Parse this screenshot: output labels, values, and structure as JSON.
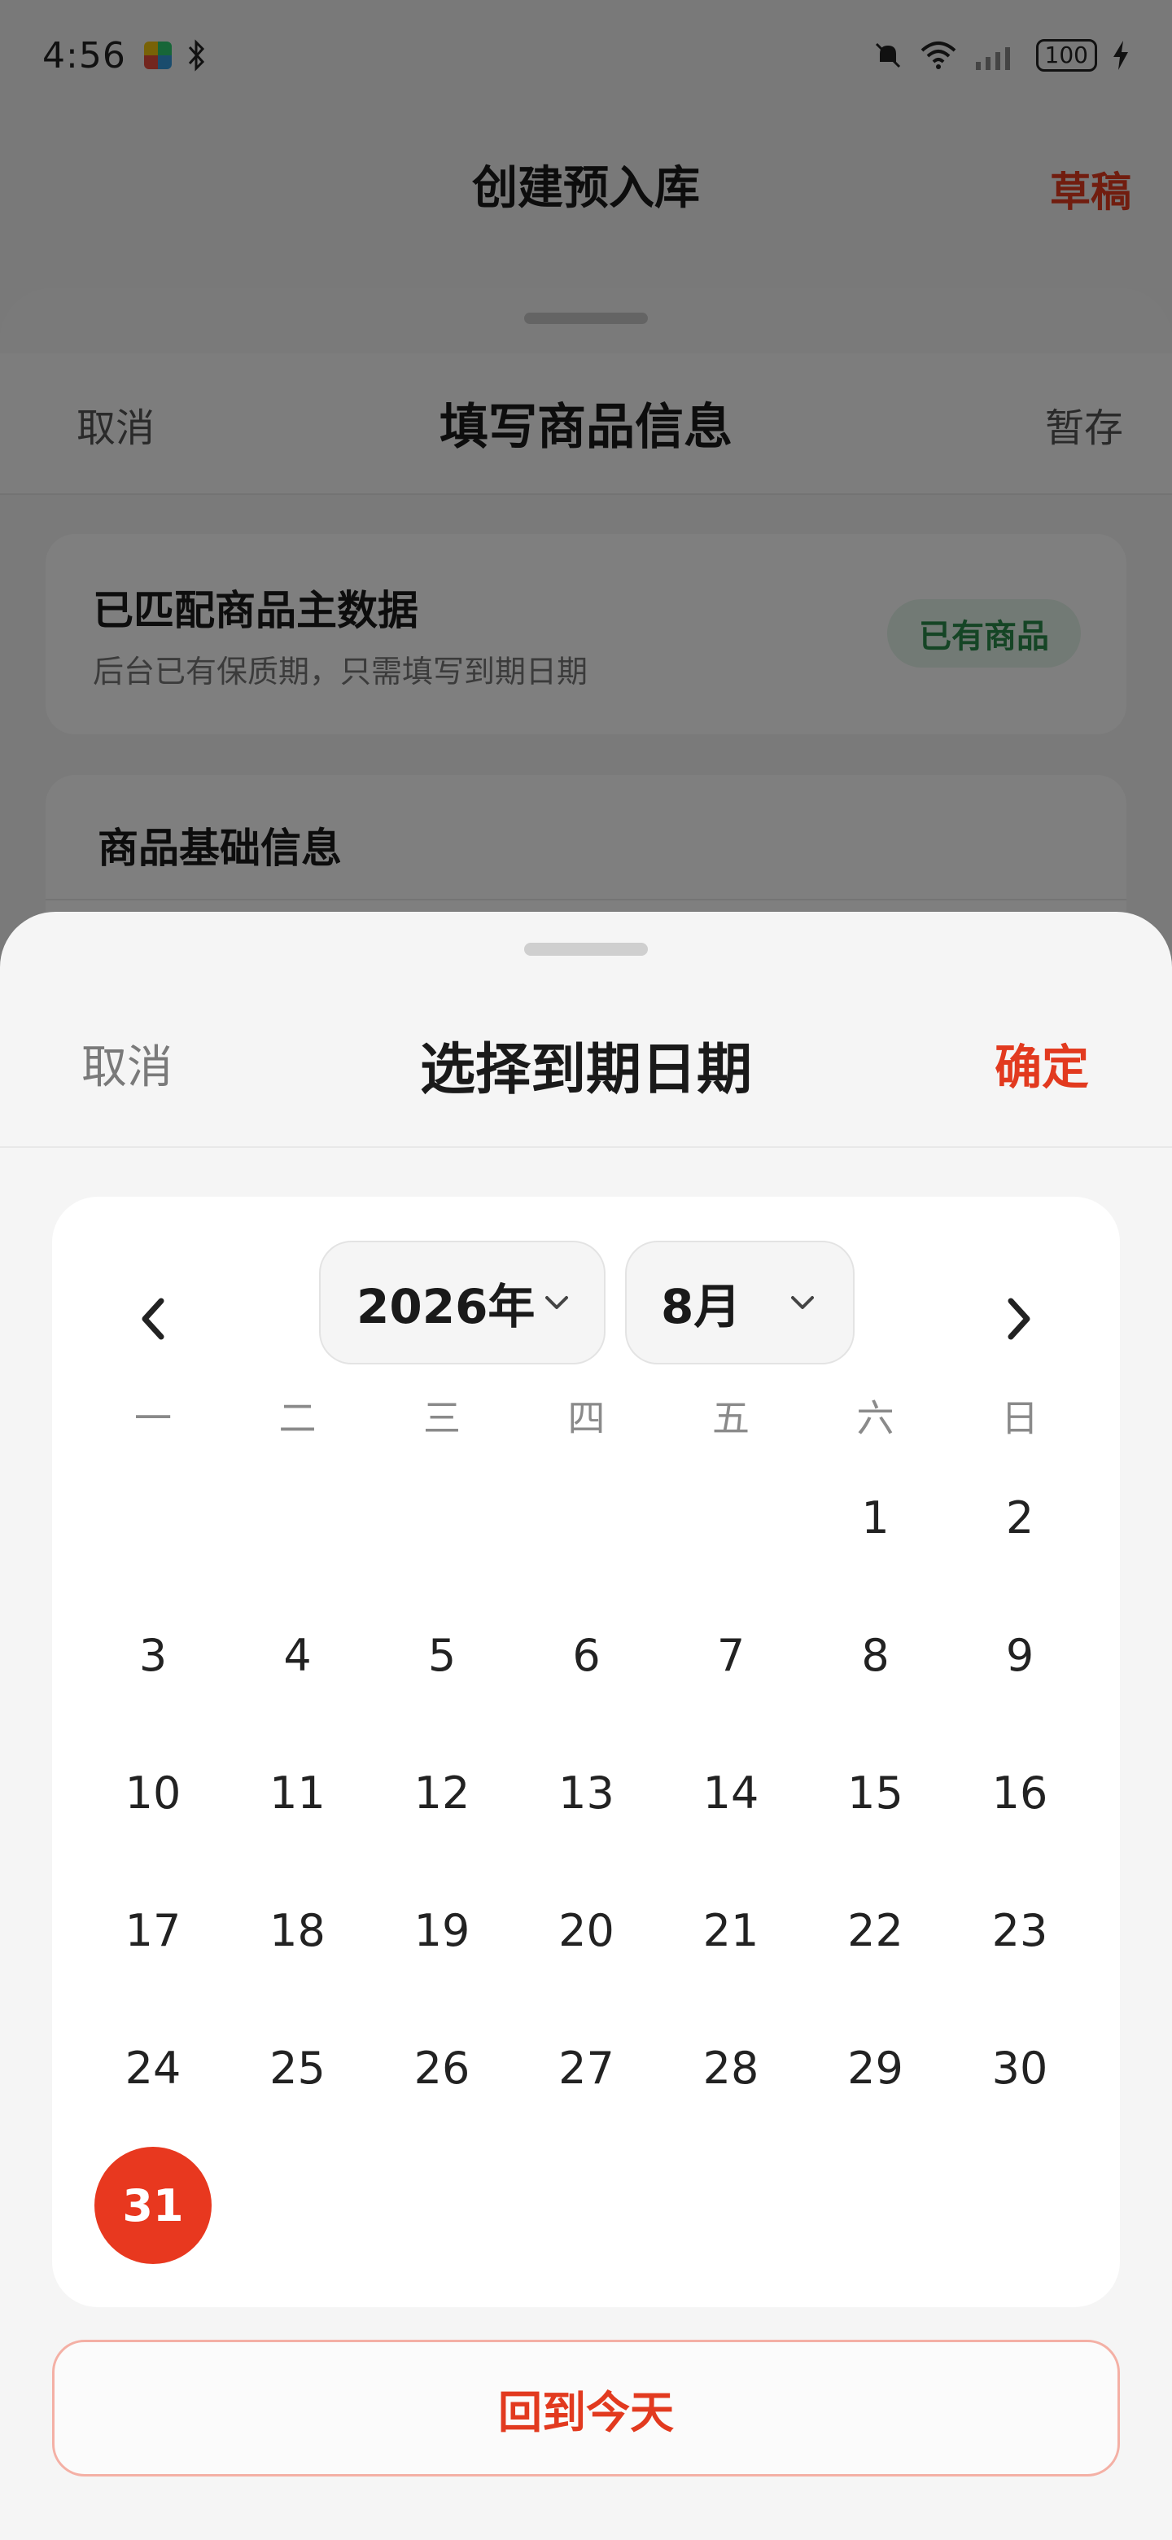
{
  "status_bar": {
    "time": "4:56",
    "battery": "100"
  },
  "background": {
    "app_title": "创建预入库",
    "draft_label": "草稿",
    "sheet": {
      "cancel_label": "取消",
      "title": "填写商品信息",
      "save_label": "暂存"
    },
    "match_card": {
      "title": "已匹配商品主数据",
      "subtitle": "后台已有保质期，只需填写到期日期",
      "tag": "已有商品"
    },
    "basic_info": {
      "title": "商品基础信息"
    }
  },
  "picker": {
    "cancel_label": "取消",
    "title": "选择到期日期",
    "confirm_label": "确定",
    "year_label": "2026年",
    "month_label": "8月",
    "weekdays": [
      "一",
      "二",
      "三",
      "四",
      "五",
      "六",
      "日"
    ],
    "first_weekday_index": 5,
    "days_in_month": 31,
    "selected_day": 31,
    "today_button": "回到今天"
  },
  "colors": {
    "accent": "#e23a1f",
    "selected_bg": "#e8381f",
    "tag_green": "#2b8a4a"
  }
}
